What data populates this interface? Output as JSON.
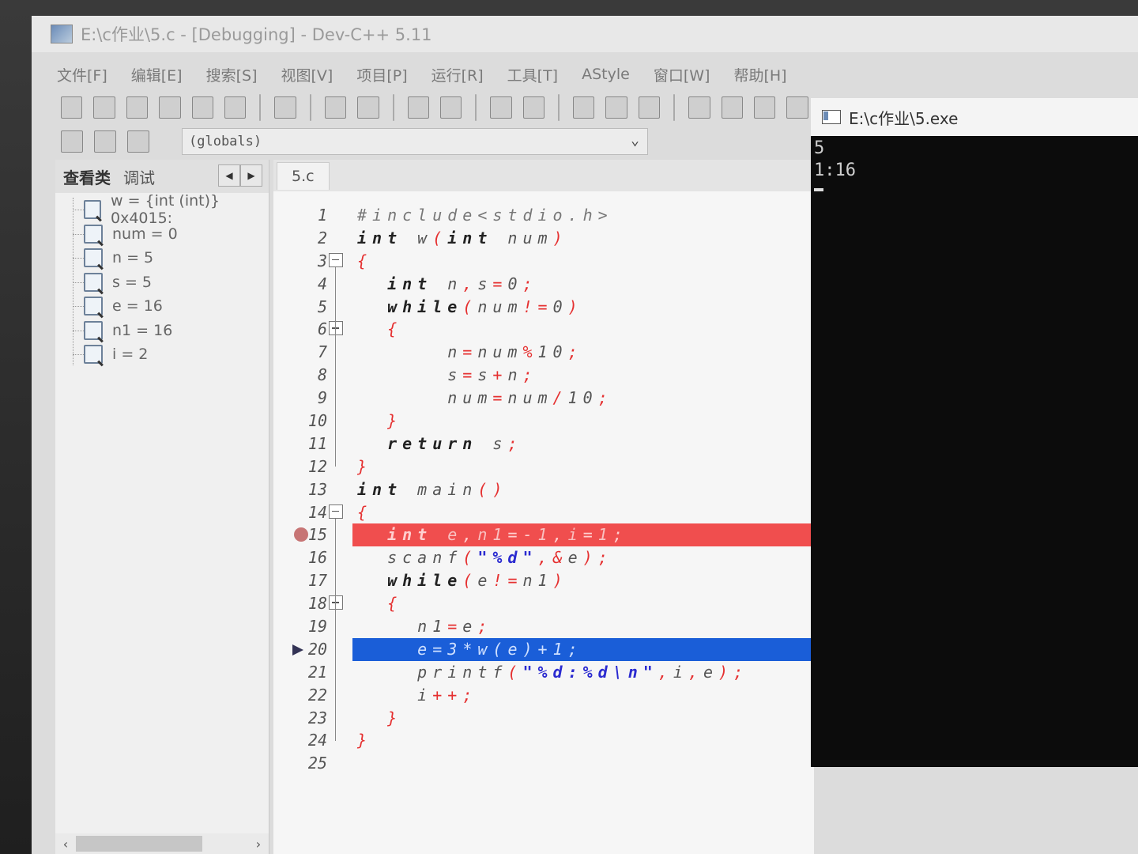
{
  "window": {
    "title": "E:\\c作业\\5.c - [Debugging] - Dev-C++ 5.11"
  },
  "menu": [
    "文件[F]",
    "编辑[E]",
    "搜索[S]",
    "视图[V]",
    "项目[P]",
    "运行[R]",
    "工具[T]",
    "AStyle",
    "窗口[W]",
    "帮助[H]"
  ],
  "toolbar": {
    "globals_value": "(globals)"
  },
  "left_panel": {
    "tabs": [
      "查看类",
      "调试"
    ],
    "nav_prev": "◀",
    "nav_next": "▶",
    "watch": [
      "w = {int (int)} 0x4015:",
      "num = 0",
      "n = 5",
      "s = 5",
      "e = 16",
      "n1 = 16",
      "i = 2"
    ],
    "scroll_left": "‹",
    "scroll_right": "›"
  },
  "editor": {
    "tab": "5.c",
    "lines": [
      {
        "no": "1",
        "text": "#include<stdio.h>"
      },
      {
        "no": "2",
        "text": "int w(int num)"
      },
      {
        "no": "3",
        "text": "{"
      },
      {
        "no": "4",
        "text": "  int n,s=0;"
      },
      {
        "no": "5",
        "text": "  while(num!=0)"
      },
      {
        "no": "6",
        "text": "  {"
      },
      {
        "no": "7",
        "text": "      n=num%10;"
      },
      {
        "no": "8",
        "text": "      s=s+n;"
      },
      {
        "no": "9",
        "text": "      num=num/10;"
      },
      {
        "no": "10",
        "text": "  }"
      },
      {
        "no": "11",
        "text": "  return s;"
      },
      {
        "no": "12",
        "text": "}"
      },
      {
        "no": "13",
        "text": "int main()"
      },
      {
        "no": "14",
        "text": "{"
      },
      {
        "no": "15",
        "text": "  int e,n1=-1,i=1;"
      },
      {
        "no": "16",
        "text": "  scanf(\"%d\",&e);"
      },
      {
        "no": "17",
        "text": "  while(e!=n1)"
      },
      {
        "no": "18",
        "text": "  {"
      },
      {
        "no": "19",
        "text": "    n1=e;"
      },
      {
        "no": "20",
        "text": "    e=3*w(e)+1;"
      },
      {
        "no": "21",
        "text": "    printf(\"%d:%d\\n\",i,e);"
      },
      {
        "no": "22",
        "text": "    i++;"
      },
      {
        "no": "23",
        "text": "  }"
      },
      {
        "no": "24",
        "text": "}"
      },
      {
        "no": "25",
        "text": ""
      }
    ],
    "breakpoint_line": 15,
    "exec_line": 20
  },
  "console": {
    "title": "E:\\c作业\\5.exe",
    "output": [
      "5",
      "1:16"
    ]
  },
  "colors": {
    "breakpoint": "#f04e4e",
    "exec": "#1a5ed8",
    "console_bg": "#0c0c0c"
  }
}
